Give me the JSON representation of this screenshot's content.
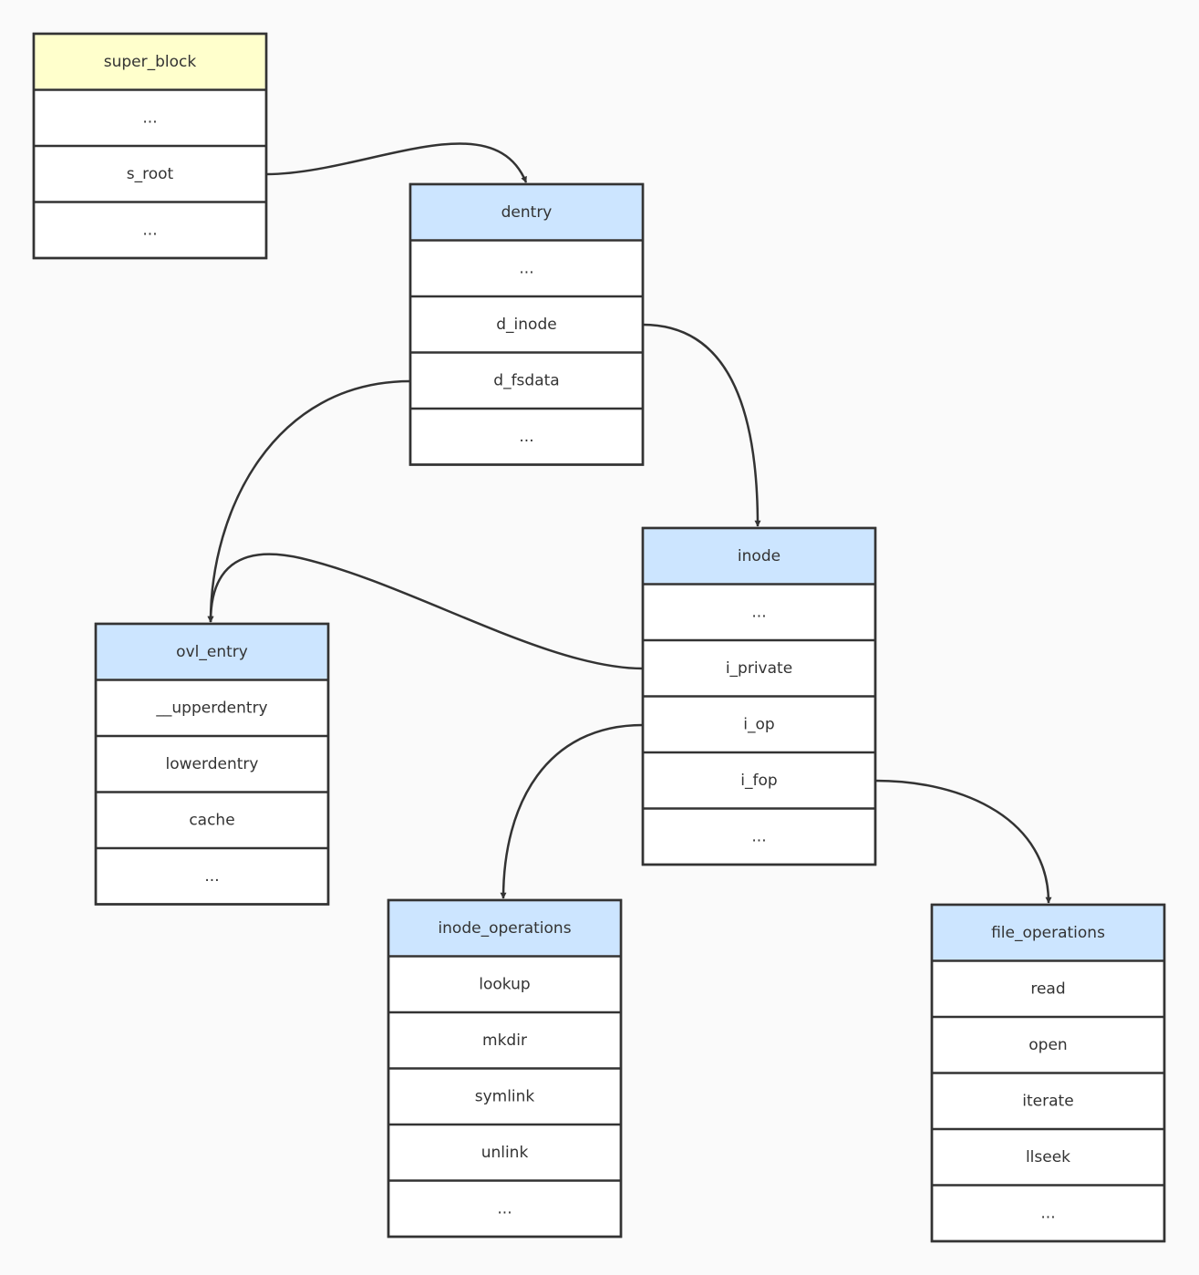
{
  "colors": {
    "background": "#fafafa",
    "root_header": "#ffffcc",
    "struct_header": "#cce5ff",
    "stroke": "#333333"
  },
  "structs": [
    {
      "id": "super_block",
      "title": "super_block",
      "header_color": "#ffffcc",
      "fields": [
        "...",
        "s_root",
        "..."
      ]
    },
    {
      "id": "dentry",
      "title": "dentry",
      "header_color": "#cce5ff",
      "fields": [
        "...",
        "d_inode",
        "d_fsdata",
        "..."
      ]
    },
    {
      "id": "inode",
      "title": "inode",
      "header_color": "#cce5ff",
      "fields": [
        "...",
        "i_private",
        "i_op",
        "i_fop",
        "..."
      ]
    },
    {
      "id": "ovl_entry",
      "title": "ovl_entry",
      "header_color": "#cce5ff",
      "fields": [
        "__upperdentry",
        "lowerdentry",
        "cache",
        "..."
      ]
    },
    {
      "id": "inode_operations",
      "title": "inode_operations",
      "header_color": "#cce5ff",
      "fields": [
        "lookup",
        "mkdir",
        "symlink",
        "unlink",
        "..."
      ]
    },
    {
      "id": "file_operations",
      "title": "file_operations",
      "header_color": "#cce5ff",
      "fields": [
        "read",
        "open",
        "iterate",
        "llseek",
        "..."
      ]
    }
  ],
  "edges": [
    {
      "from": "super_block.s_root",
      "to": "dentry"
    },
    {
      "from": "dentry.d_inode",
      "to": "inode"
    },
    {
      "from": "dentry.d_fsdata",
      "to": "ovl_entry"
    },
    {
      "from": "inode.i_private",
      "to": "ovl_entry"
    },
    {
      "from": "inode.i_op",
      "to": "inode_operations"
    },
    {
      "from": "inode.i_fop",
      "to": "file_operations"
    }
  ]
}
